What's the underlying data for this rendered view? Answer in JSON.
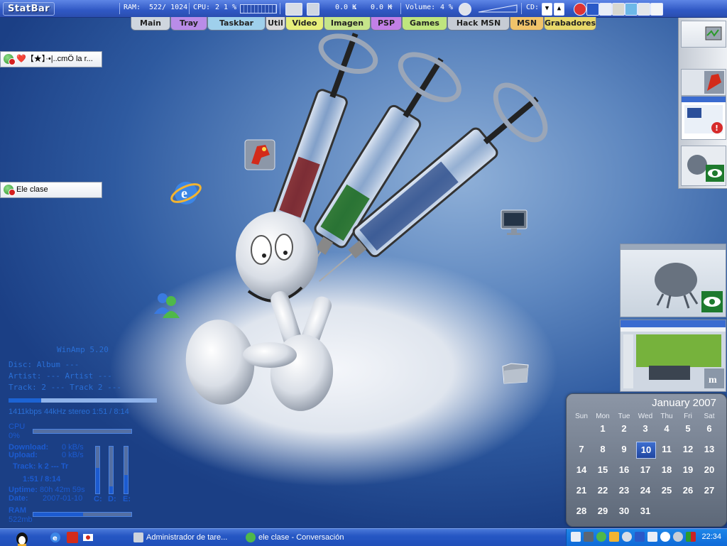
{
  "statbar": {
    "logo": "StatBar",
    "ram_label": "RAM:",
    "ram_value": "522/ 1024",
    "cpu_label": "CPU:",
    "cpu_value": "2 1 %",
    "net_down": "0.0 K",
    "net_up": "0.0 K",
    "volume_label": "Volume:",
    "volume_value": "4 %",
    "cd_label": "CD:"
  },
  "tabs": [
    {
      "label": "Main",
      "color": "#cfd6de"
    },
    {
      "label": "Tray",
      "color": "#b98ce8"
    },
    {
      "label": "Taskbar",
      "color": "#9fd0ec"
    },
    {
      "label": "Util",
      "color": "#d9d9d9"
    },
    {
      "label": "Video",
      "color": "#e7ef7a"
    },
    {
      "label": "Imagen",
      "color": "#c6e58a"
    },
    {
      "label": "PSP",
      "color": "#c280e6"
    },
    {
      "label": "Games",
      "color": "#bfe57e"
    },
    {
      "label": "Hack MSN",
      "color": "#c6ccd4"
    },
    {
      "label": "MSN",
      "color": "#f1c36a"
    },
    {
      "label": "Grabadores",
      "color": "#e8d96a"
    }
  ],
  "msn_popups": [
    {
      "text": "❤️【★】·•|..cmÖ la r..."
    },
    {
      "text": "Ele clase"
    }
  ],
  "winamp": {
    "title": "WinAmp 5.20",
    "disc": "Disc:    Album    ---",
    "artist": "Artist:   ---   Artist   ---",
    "track": "Track:  2    ---   Track 2   ---",
    "progress": 0.22,
    "info": "1411kbps 44kHz stereo     1:51 / 8:14"
  },
  "sysmon": {
    "cpu_label": "CPU",
    "cpu_value": "0%",
    "cpu_level": 0.0,
    "download_label": "Download:",
    "download_value": "0 kB/s",
    "upload_label": "Upload:",
    "upload_value": "0 kB/s",
    "track": "Track: k 2  ---  Tr",
    "time": "1:51 / 8:14",
    "uptime_label": "Uptime:",
    "uptime_value": "80h 42m 59s",
    "date_label": "Date:",
    "date_value": "2007-01-10",
    "ram_label": "RAM",
    "ram_value": "522mb",
    "ram_level": 0.51,
    "drives": [
      {
        "label": "C:",
        "level": 0.55
      },
      {
        "label": "D:",
        "level": 0.15
      },
      {
        "label": "E:",
        "level": 0.4
      }
    ]
  },
  "calendar": {
    "title": "January 2007",
    "weekdays": [
      "Sun",
      "Mon",
      "Tue",
      "Wed",
      "Thu",
      "Fri",
      "Sat"
    ],
    "weeks": [
      [
        "",
        "1",
        "2",
        "3",
        "4",
        "5",
        "6"
      ],
      [
        "7",
        "8",
        "9",
        "10",
        "11",
        "12",
        "13"
      ],
      [
        "14",
        "15",
        "16",
        "17",
        "18",
        "19",
        "20"
      ],
      [
        "21",
        "22",
        "23",
        "24",
        "25",
        "26",
        "27"
      ],
      [
        "28",
        "29",
        "30",
        "31",
        "",
        "",
        ""
      ]
    ],
    "today": "10"
  },
  "taskbar": {
    "tasks": [
      {
        "label": "Administrador de tare...",
        "icon": "task-manager-icon"
      },
      {
        "label": "ele clase - Conversación",
        "icon": "msn-buddy-icon"
      }
    ],
    "clock": "22:34"
  }
}
